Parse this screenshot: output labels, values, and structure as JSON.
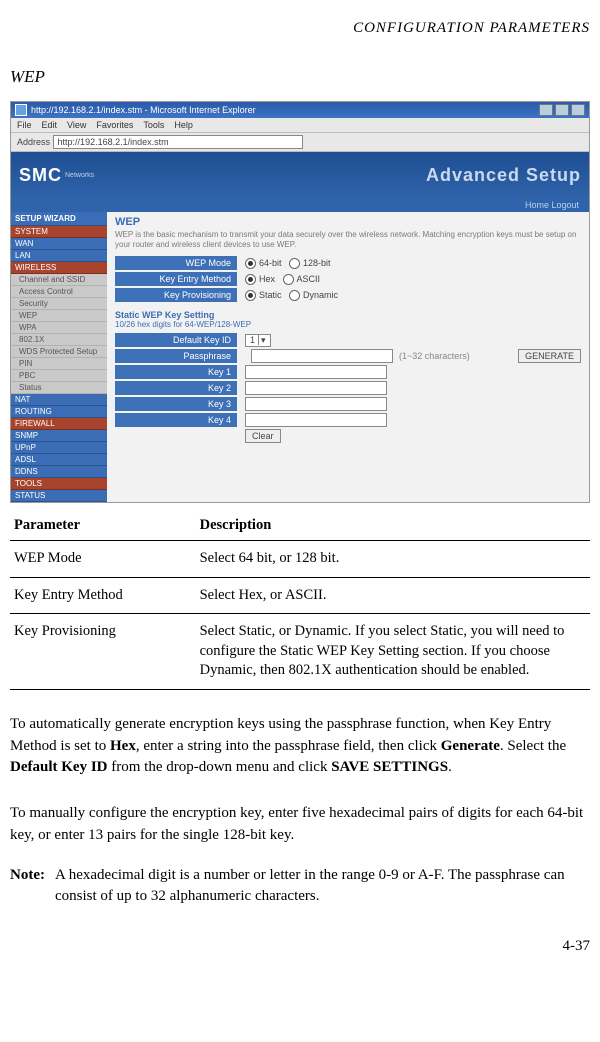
{
  "running_head": "CONFIGURATION PARAMETERS",
  "section_title": "WEP",
  "browser": {
    "title": "http://192.168.2.1/index.stm - Microsoft Internet Explorer",
    "menu": [
      "File",
      "Edit",
      "View",
      "Favorites",
      "Tools",
      "Help"
    ],
    "addr_label": "Address",
    "addr_value": "http://192.168.2.1/index.stm"
  },
  "app": {
    "brand": "SMC",
    "brand_sub": "Networks",
    "banner": "Advanced Setup",
    "links": "Home  Logout",
    "sidebar": {
      "wizard": "SETUP WIZARD",
      "items": [
        "SYSTEM",
        "WAN",
        "LAN",
        "WIRELESS"
      ],
      "subs": [
        "Channel and SSID",
        "Access Control",
        "Security",
        "WEP",
        "WPA",
        "802.1X",
        "WDS Protected Setup",
        "PIN",
        "PBC",
        "Status"
      ],
      "rest": [
        "NAT",
        "ROUTING",
        "FIREWALL",
        "SNMP",
        "UPnP",
        "ADSL",
        "DDNS",
        "TOOLS",
        "STATUS"
      ]
    },
    "panel": {
      "title": "WEP",
      "desc": "WEP is the basic mechanism to transmit your data securely over the wireless network. Matching encryption keys must be setup on your router and wireless client devices to use WEP.",
      "rows": {
        "wep_mode": {
          "label": "WEP Mode",
          "opt1": "64-bit",
          "opt2": "128-bit"
        },
        "entry": {
          "label": "Key Entry Method",
          "opt1": "Hex",
          "opt2": "ASCII"
        },
        "prov": {
          "label": "Key Provisioning",
          "opt1": "Static",
          "opt2": "Dynamic"
        }
      },
      "static_title": "Static WEP Key Setting",
      "static_hint": "10/26 hex digits for 64-WEP/128-WEP",
      "default_key": {
        "label": "Default Key ID",
        "value": "1"
      },
      "passphrase": {
        "label": "Passphrase",
        "hint": "(1~32 characters)",
        "btn": "GENERATE"
      },
      "keys": {
        "k1": "Key 1",
        "k2": "Key 2",
        "k3": "Key 3",
        "k4": "Key 4"
      },
      "clear": "Clear"
    }
  },
  "table": {
    "headers": {
      "p": "Parameter",
      "d": "Description"
    },
    "rows": [
      {
        "p": "WEP Mode",
        "d": "Select 64 bit, or 128 bit."
      },
      {
        "p": "Key Entry Method",
        "d": "Select Hex, or ASCII."
      },
      {
        "p": "Key Provisioning",
        "d": "Select Static, or Dynamic. If you select Static, you will need to configure the Static WEP Key Setting section. If you choose Dynamic, then 802.1X authentication should be enabled."
      }
    ]
  },
  "para1_a": "To automatically generate encryption keys using the passphrase function, when Key Entry Method is set to ",
  "para1_b": "Hex",
  "para1_c": ", enter a string into the passphrase field, then click ",
  "para1_d": "Generate",
  "para1_e": ". Select the ",
  "para1_f": "Default Key ID",
  "para1_g": " from the drop-down menu and click ",
  "para1_h": "SAVE SETTINGS",
  "para1_i": ".",
  "para2": "To manually configure the encryption key, enter five hexadecimal pairs of digits for each 64-bit key, or enter 13 pairs for the single 128-bit key.",
  "note_label": "Note:",
  "note_text": "A hexadecimal digit is a number or letter in the range 0-9 or A-F. The passphrase can consist of up to 32 alphanumeric characters.",
  "page_num": "4-37"
}
